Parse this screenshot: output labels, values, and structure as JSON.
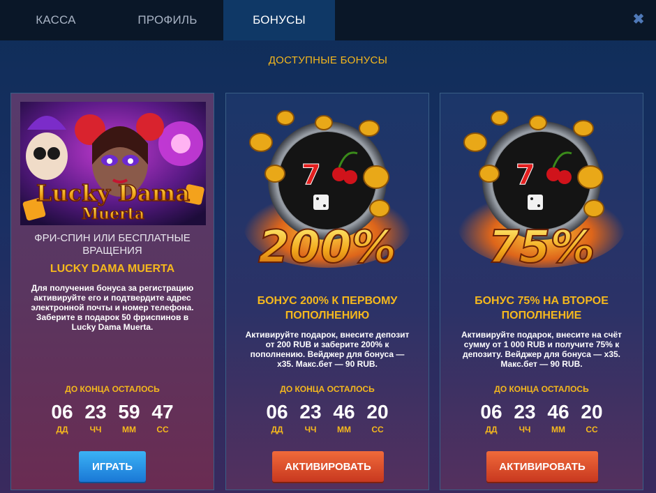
{
  "tabs": [
    {
      "label": "КАССА",
      "active": false
    },
    {
      "label": "ПРОФИЛЬ",
      "active": false
    },
    {
      "label": "БОНУСЫ",
      "active": true
    }
  ],
  "close_icon": "close-icon",
  "section_title": "ДОСТУПНЫЕ БОНУСЫ",
  "cards": [
    {
      "image_text_line1": "Lucky Dama",
      "image_text_line2": "Muerta",
      "subtitle": "ФРИ-СПИН ИЛИ БЕСПЛАТНЫЕ ВРАЩЕНИЯ",
      "title": "LUCKY DAMA MUERTA",
      "description": "Для получения бонуса за регистрацию активируйте его и подтвердите адрес электронной почты и номер телефона. Заберите в подарок 50 фриспинов в Lucky Dama Muerta.",
      "timer_label": "ДО КОНЦА ОСТАЛОСЬ",
      "timer": {
        "dd": "06",
        "hh": "23",
        "mm": "59",
        "ss": "47"
      },
      "button_label": "ИГРАТЬ"
    },
    {
      "image_text": "200%",
      "title": "БОНУС 200% К ПЕРВОМУ ПОПОЛНЕНИЮ",
      "description": "Активируйте подарок, внесите депозит от 200 RUB и заберите 200% к пополнению. Вейджер для бонуса — x35. Макс.бет — 90 RUB.",
      "timer_label": "ДО КОНЦА ОСТАЛОСЬ",
      "timer": {
        "dd": "06",
        "hh": "23",
        "mm": "46",
        "ss": "20"
      },
      "button_label": "АКТИВИРОВАТЬ"
    },
    {
      "image_text": "75%",
      "title": "БОНУС 75% НА ВТОРОЕ ПОПОЛНЕНИЕ",
      "description": "Активируйте подарок, внесите на счёт сумму от 1 000 RUB и получите 75% к депозиту. Вейджер для бонуса — x35. Макс.бет — 90 RUB.",
      "timer_label": "ДО КОНЦА ОСТАЛОСЬ",
      "timer": {
        "dd": "06",
        "hh": "23",
        "mm": "46",
        "ss": "20"
      },
      "button_label": "АКТИВИРОВАТЬ"
    }
  ],
  "timer_units": {
    "dd": "ДД",
    "hh": "ЧЧ",
    "mm": "ММ",
    "ss": "СС"
  },
  "colors": {
    "accent": "#f5b81d",
    "play_button": "#2a93e6",
    "activate_button": "#e0512c",
    "active_tab": "#0f3866"
  }
}
